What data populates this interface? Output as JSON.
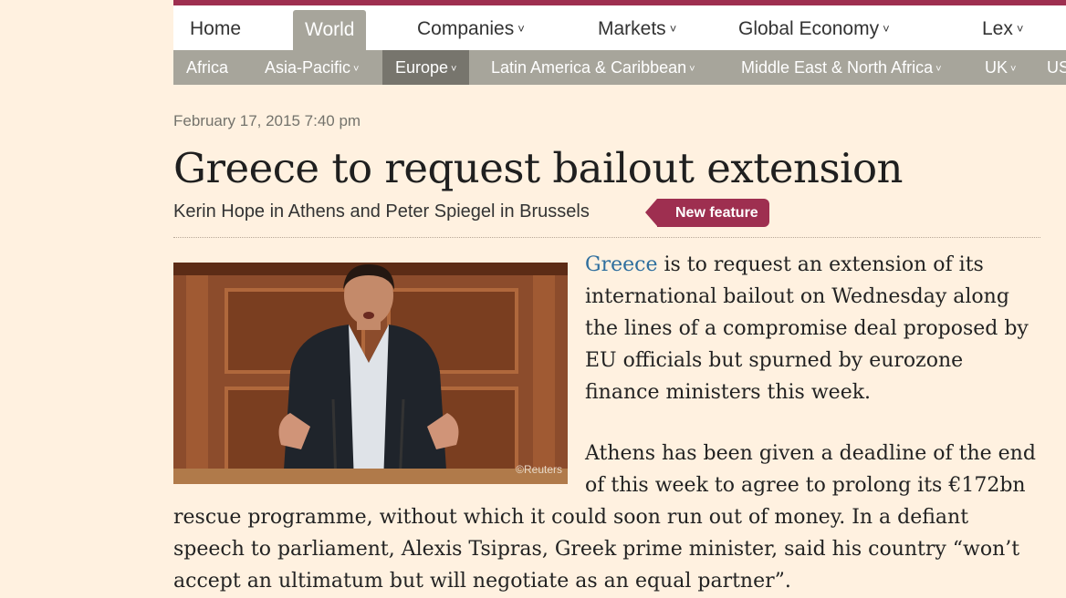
{
  "nav": {
    "main": [
      {
        "label": "Home",
        "dropdown": false
      },
      {
        "label": "World",
        "dropdown": false,
        "active": true
      },
      {
        "label": "Companies",
        "dropdown": true
      },
      {
        "label": "Markets",
        "dropdown": true
      },
      {
        "label": "Global Economy",
        "dropdown": true
      },
      {
        "label": "Lex",
        "dropdown": true
      }
    ],
    "sub": [
      {
        "label": "Africa",
        "dropdown": false
      },
      {
        "label": "Asia-Pacific",
        "dropdown": true
      },
      {
        "label": "Europe",
        "dropdown": true,
        "active": true
      },
      {
        "label": "Latin America & Caribbean",
        "dropdown": true
      },
      {
        "label": "Middle East & North Africa",
        "dropdown": true
      },
      {
        "label": "UK",
        "dropdown": true
      },
      {
        "label": "US",
        "dropdown": false
      }
    ],
    "chevron": "˅"
  },
  "article": {
    "date": "February 17, 2015 7:40 pm",
    "headline": "Greece to request bailout extension",
    "byline": "Kerin Hope in Athens and Peter Spiegel in Brussels",
    "badge": "New feature",
    "photo_credit": "©Reuters",
    "para1": {
      "link": "Greece",
      "lines": [
        " is to request an extension of its",
        "international bailout on Wednesday along",
        "the lines of a compromise deal proposed by",
        "EU officials but spurned by eurozone",
        "finance ministers this week."
      ]
    },
    "para2": {
      "lines": [
        "Athens has been given a deadline of the end",
        "of this week to agree to prolong its €172bn",
        "rescue programme, without which it could soon run out of money. In a defiant",
        "speech to parliament, Alexis Tsipras, Greek prime minister, said his country “won’t",
        "accept an ultimatum but will negotiate as an equal partner”."
      ]
    }
  },
  "colors": {
    "page_bg": "#fff1e0",
    "accent": "#9e2f50",
    "nav_grey": "#a7a59b",
    "nav_dark": "#77756d",
    "link": "#2e6e9e"
  }
}
